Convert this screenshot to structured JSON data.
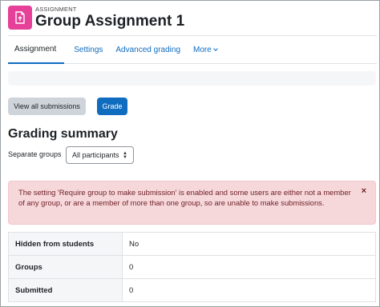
{
  "header": {
    "kicker": "ASSIGNMENT",
    "title": "Group Assignment 1",
    "icon": "assignment-icon",
    "icon_color": "#e64099"
  },
  "tabs": [
    {
      "label": "Assignment",
      "active": true
    },
    {
      "label": "Settings",
      "active": false
    },
    {
      "label": "Advanced grading",
      "active": false
    },
    {
      "label": "More",
      "active": false
    }
  ],
  "actions": {
    "view_all_label": "View all submissions",
    "grade_label": "Grade"
  },
  "section_title": "Grading summary",
  "groups_filter": {
    "label": "Separate groups",
    "selected": "All participants"
  },
  "alert": {
    "message": "The setting 'Require group to make submission' is enabled and some users are either not a member of any group, or are a member of more than one group, so are unable to make submissions.",
    "close_glyph": "×"
  },
  "summary": {
    "rows": [
      {
        "label": "Hidden from students",
        "value": "No"
      },
      {
        "label": "Groups",
        "value": "0"
      },
      {
        "label": "Submitted",
        "value": "0"
      }
    ]
  },
  "colors": {
    "primary": "#0f6cbf",
    "alert_bg": "#f6d8db",
    "alert_text": "#6e1d24"
  }
}
